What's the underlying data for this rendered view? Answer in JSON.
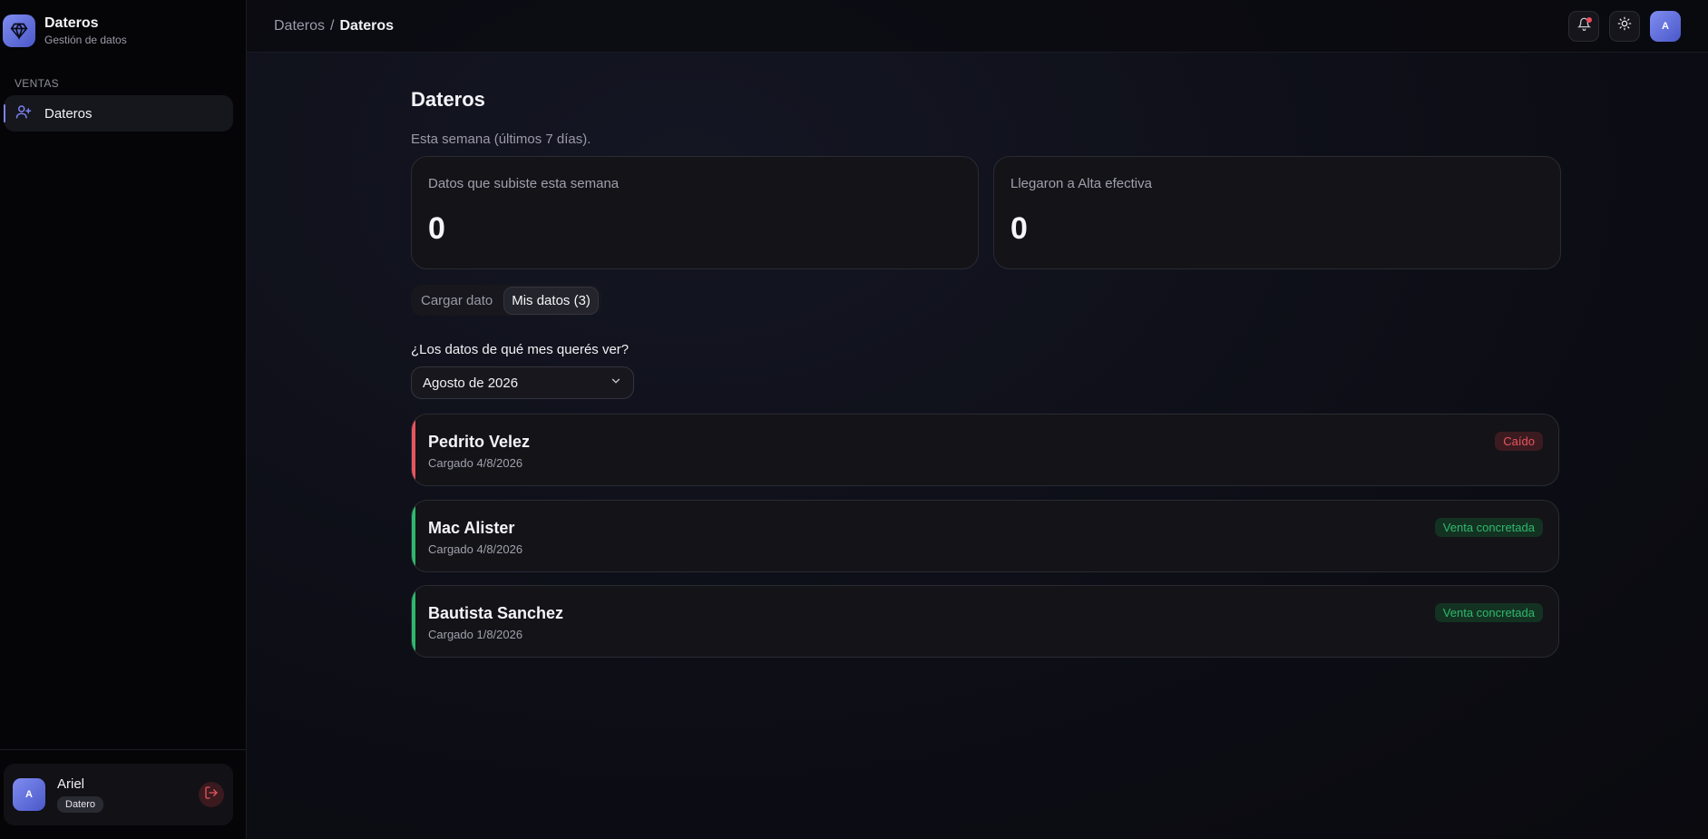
{
  "brand": {
    "title": "Dateros",
    "subtitle": "Gestión de datos"
  },
  "sidebar": {
    "section": "VENTAS",
    "items": [
      {
        "label": "Dateros",
        "icon": "user-plus-icon",
        "active": true
      }
    ]
  },
  "user": {
    "avatar": "A",
    "name": "Ariel",
    "role": "Datero"
  },
  "topbar": {
    "breadcrumb": [
      "Dateros",
      "/",
      "Dateros"
    ],
    "avatar": "A"
  },
  "page": {
    "title": "Dateros",
    "week_label": "Esta semana (últimos 7 días).",
    "stats": [
      {
        "label": "Datos que subiste esta semana",
        "value": "0"
      },
      {
        "label": "Llegaron a Alta efectiva",
        "value": "0"
      }
    ],
    "tabs": [
      {
        "label": "Cargar dato",
        "active": false
      },
      {
        "label": "Mis datos (3)",
        "active": true
      }
    ],
    "month_question": "¿Los datos de qué mes querés ver?",
    "month_selected": "Agosto de 2026",
    "records": [
      {
        "name": "Pedrito Velez",
        "date": "Cargado 4/8/2026",
        "status": "Caído"
      },
      {
        "name": "Mac Alister",
        "date": "Cargado 4/8/2026",
        "status": "Venta concretada"
      },
      {
        "name": "Bautista Sanchez",
        "date": "Cargado 1/8/2026",
        "status": "Venta concretada"
      }
    ]
  },
  "colors": {
    "accent": "#7b82f0",
    "danger": "#e8555f",
    "danger_bg": "#3b1b20",
    "success": "#2fb86d",
    "success_bg": "#143222"
  }
}
